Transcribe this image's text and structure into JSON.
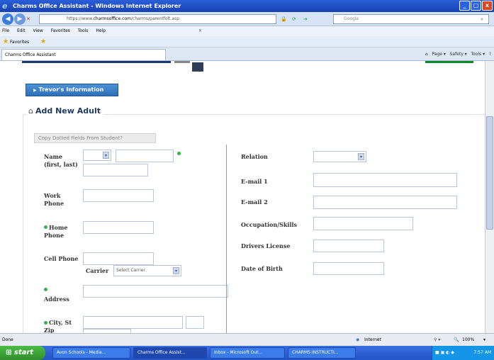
{
  "window": {
    "title": "Charms Office Assistant - Windows Internet Explorer",
    "controls": [
      "_",
      "□",
      "x"
    ]
  },
  "address": {
    "url_prefix": "https://www.",
    "url_domain": "charmsoffice.com",
    "url_rest": "/charms/parentfolt.asp",
    "search_placeholder": "Google"
  },
  "menu": [
    "File",
    "Edit",
    "View",
    "Favorites",
    "Tools",
    "Help"
  ],
  "favorites": {
    "label": "Favorites"
  },
  "tab": {
    "label": "Charms Office Assistant"
  },
  "commands": {
    "page": "Page",
    "safety": "Safety",
    "tools": "Tools"
  },
  "page": {
    "info_button": "Trevor's Information",
    "heading": "Add New Adult",
    "copy_button": "Copy Dotted Fields From Student?",
    "left": {
      "name_label": "Name (first, last)",
      "work_phone_label": "Work Phone",
      "home_phone_label": "Home Phone",
      "cell_phone_label": "Cell Phone",
      "carrier_label": "Carrier",
      "carrier_value": "Select Carrier",
      "address_label": "Address",
      "city_label": "City, St Zip"
    },
    "right": {
      "relation_label": "Relation",
      "email1_label": "E-mail 1",
      "email2_label": "E-mail 2",
      "occupation_label": "Occupation/Skills",
      "drivers_label": "Drivers License",
      "dob_label": "Date of Birth"
    }
  },
  "status": {
    "left": "Done",
    "zone": "Internet",
    "zoom": "100%"
  },
  "taskbar": {
    "start": "start",
    "tasks": [
      "Avon Schools - Media...",
      "Charms Office Assist...",
      "Inbox - Microsoft Out...",
      "CHARMS INSTRUCTI..."
    ],
    "clock": "7:57 AM"
  },
  "colors": {
    "accent": "#2d6fb8",
    "heading": "#1e3a5f",
    "required_dot": "#2fb44a"
  }
}
